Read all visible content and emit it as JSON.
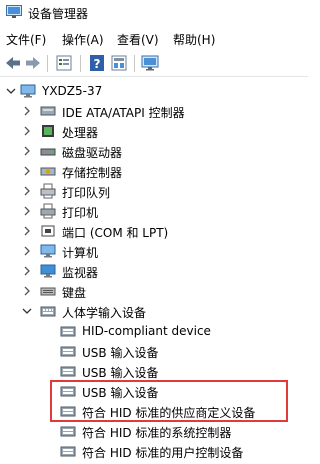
{
  "window": {
    "title": "设备管理器"
  },
  "menu": [
    "文件(F)",
    "操作(A)",
    "查看(V)",
    "帮助(H)"
  ],
  "toolbar": {
    "icons": [
      "back-arrow-icon",
      "forward-arrow-icon",
      "properties-icon",
      "help-icon",
      "show-hidden-icon",
      "monitor-icon"
    ]
  },
  "tree": {
    "root": "YXDZ5-37",
    "categories": [
      {
        "label": "IDE ATA/ATAPI 控制器",
        "icon": "ide-controller-icon"
      },
      {
        "label": "处理器",
        "icon": "processor-icon"
      },
      {
        "label": "磁盘驱动器",
        "icon": "disk-drive-icon"
      },
      {
        "label": "存储控制器",
        "icon": "storage-controller-icon"
      },
      {
        "label": "打印队列",
        "icon": "print-queue-icon"
      },
      {
        "label": "打印机",
        "icon": "printer-icon"
      },
      {
        "label": "端口 (COM 和 LPT)",
        "icon": "port-icon"
      },
      {
        "label": "计算机",
        "icon": "computer-icon"
      },
      {
        "label": "监视器",
        "icon": "monitor-icon"
      },
      {
        "label": "键盘",
        "icon": "keyboard-icon"
      }
    ],
    "expanded_category": {
      "label": "人体学输入设备",
      "icon": "hid-icon",
      "children": [
        "HID-compliant device",
        "USB 输入设备",
        "USB 输入设备",
        "USB 输入设备",
        "符合 HID 标准的供应商定义设备",
        "符合 HID 标准的系统控制器",
        "符合 HID 标准的用户控制设备"
      ]
    }
  },
  "colors": {
    "highlight_box": "#e03a3a",
    "root_selected": "#cce8ff"
  }
}
